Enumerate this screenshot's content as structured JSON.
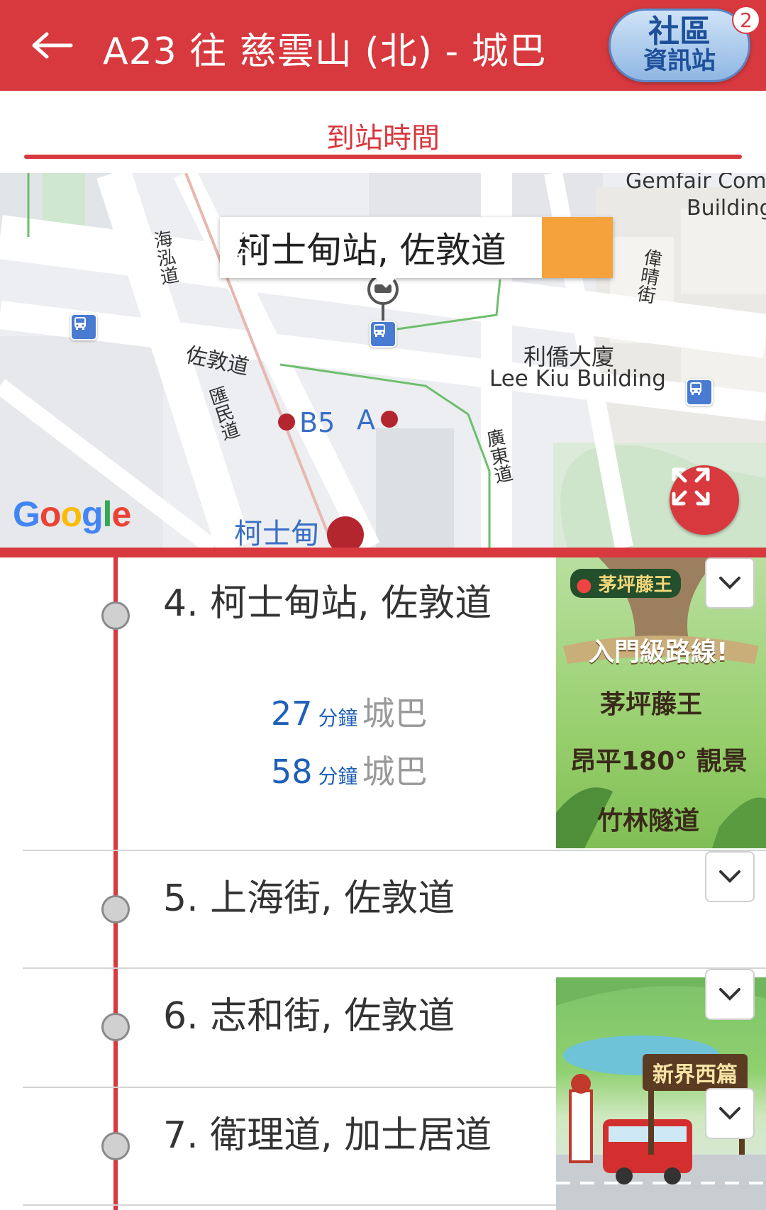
{
  "header": {
    "back_icon": "arrow-left-icon",
    "title": "A23 往 慈雲山 (北) - 城巴",
    "community_line1": "社區",
    "community_line2": "資訊站",
    "notification_count": "2"
  },
  "tab": {
    "label": "到站時間"
  },
  "map": {
    "info_window_title": "柯士甸站, 佐敦道",
    "labels": {
      "gemfair_1": "Gemfair Comm",
      "gemfair_2": "Building",
      "haihong_road": "海泓道",
      "jordan_road": "佐敦道",
      "wai_ching_street": "偉晴街",
      "lee_kiu_zh": "利僑大廈",
      "lee_kiu_en": "Lee Kiu Building",
      "wui_man_road": "匯民道",
      "exit_b5": "B5",
      "exit_a": "A",
      "canton_road": "廣東道",
      "austin_station": "柯士甸"
    },
    "google_logo": "Google"
  },
  "stops": [
    {
      "label": "4. 柯士甸站, 佐敦道",
      "etas": [
        {
          "minutes": "27",
          "unit": "分鐘",
          "company": "城巴"
        },
        {
          "minutes": "58",
          "unit": "分鐘",
          "company": "城巴"
        }
      ]
    },
    {
      "label": "5. 上海街, 佐敦道",
      "etas": []
    },
    {
      "label": "6. 志和街, 佐敦道",
      "etas": []
    },
    {
      "label": "7. 衛理道, 加士居道",
      "etas": []
    }
  ],
  "ads": {
    "lantau": {
      "location_tag": "茅坪藤王",
      "headline": "入門級路線!",
      "step1": "茅坪藤王",
      "step2": "昂平180° 靚景",
      "step3": "竹林隧道"
    },
    "new_territories": {
      "sign": "新界西篇"
    }
  },
  "colors": {
    "brand_red": "#d7393e",
    "eta_blue": "#1f5fb8",
    "nav_orange": "#f5a23c"
  }
}
